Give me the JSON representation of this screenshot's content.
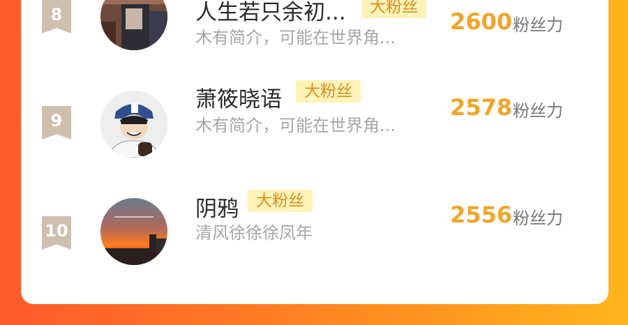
{
  "items": [
    {
      "rank": "8",
      "name": "人生若只余初...",
      "badge": "大粉丝",
      "desc": "木有简介，可能在世界角...",
      "score": "2600",
      "unit": "粉丝力"
    },
    {
      "rank": "9",
      "name": "萧筱晓语",
      "badge": "大粉丝",
      "desc": "木有简介，可能在世界角...",
      "score": "2578",
      "unit": "粉丝力"
    },
    {
      "rank": "10",
      "name": "阴鸦",
      "badge": "大粉丝",
      "desc": "清风徐徐徐凤年",
      "score": "2556",
      "unit": "粉丝力"
    }
  ],
  "colors": {
    "accent_score": "#f0a52b",
    "badge_bg": "#fff3b8",
    "badge_text": "#d98e1d",
    "rank_bg": "#cfbfae"
  }
}
